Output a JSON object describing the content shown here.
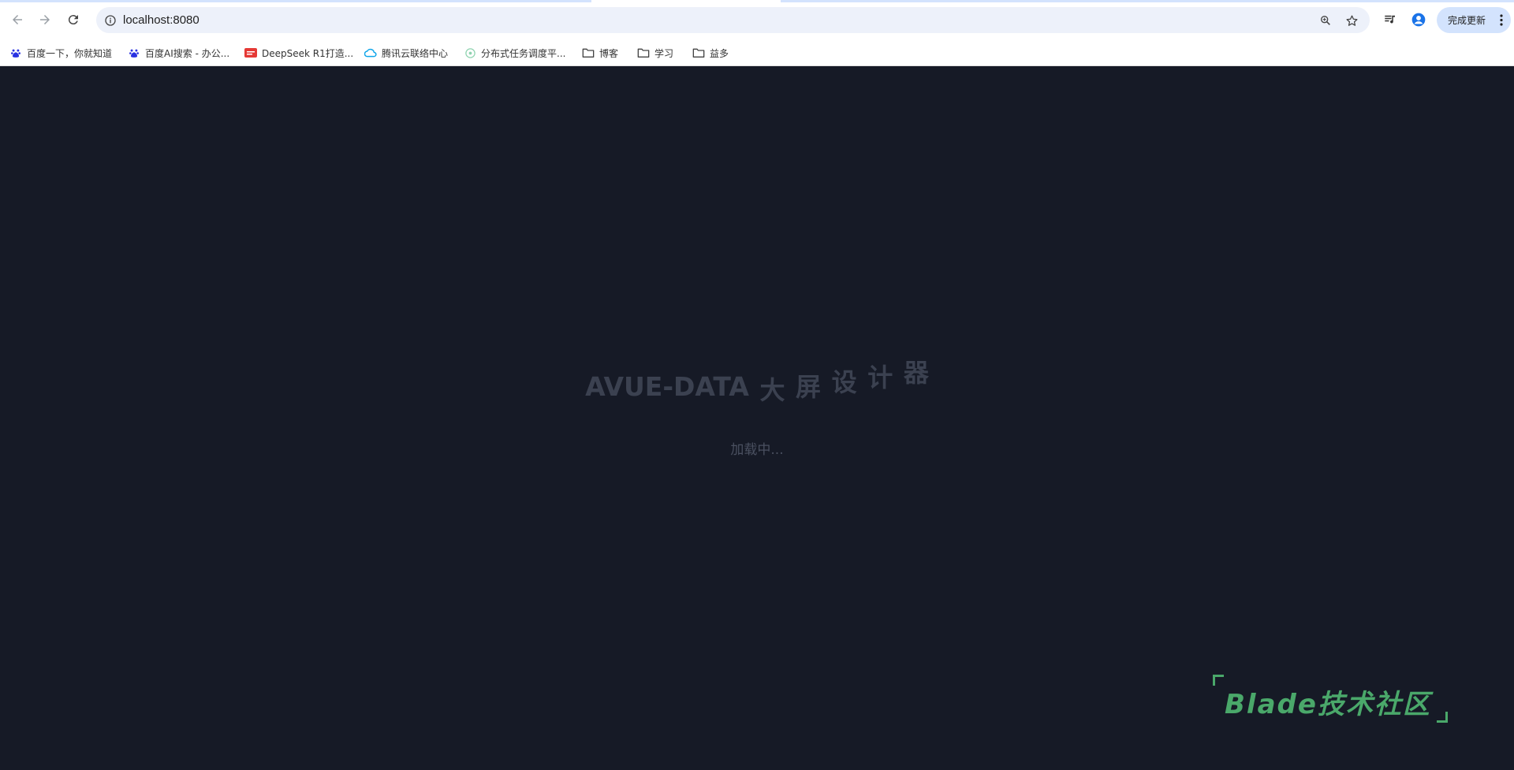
{
  "browser": {
    "url": "localhost:8080",
    "update_label": "完成更新",
    "icons": [
      "back-icon",
      "forward-icon",
      "reload-icon",
      "info-icon",
      "zoom-icon",
      "star-icon",
      "media-icon",
      "profile-icon",
      "kebab-icon"
    ]
  },
  "bookmarks": [
    {
      "label": "百度一下，你就知道",
      "icon": "baidu-paw-icon"
    },
    {
      "label": "百度AI搜索 - 办公...",
      "icon": "baidu-paw-icon"
    },
    {
      "label": "DeepSeek R1打造...",
      "icon": "red-badge-icon"
    },
    {
      "label": "腾讯云联络中心",
      "icon": "cloud-icon"
    },
    {
      "label": "分布式任务调度平...",
      "icon": "gear-badge-icon"
    },
    {
      "label": "博客",
      "icon": "folder-icon"
    },
    {
      "label": "学习",
      "icon": "folder-icon"
    },
    {
      "label": "益多",
      "icon": "folder-icon"
    }
  ],
  "page": {
    "title_en": "AVUE-DATA",
    "title_chars": [
      "大",
      "屏",
      "设",
      "计",
      "器"
    ],
    "loading_text": "加载中...",
    "brand_text": "Blade技术社区",
    "colors": {
      "background": "#161a26",
      "title": "#3b4150",
      "brand": "#4aa86a"
    }
  }
}
